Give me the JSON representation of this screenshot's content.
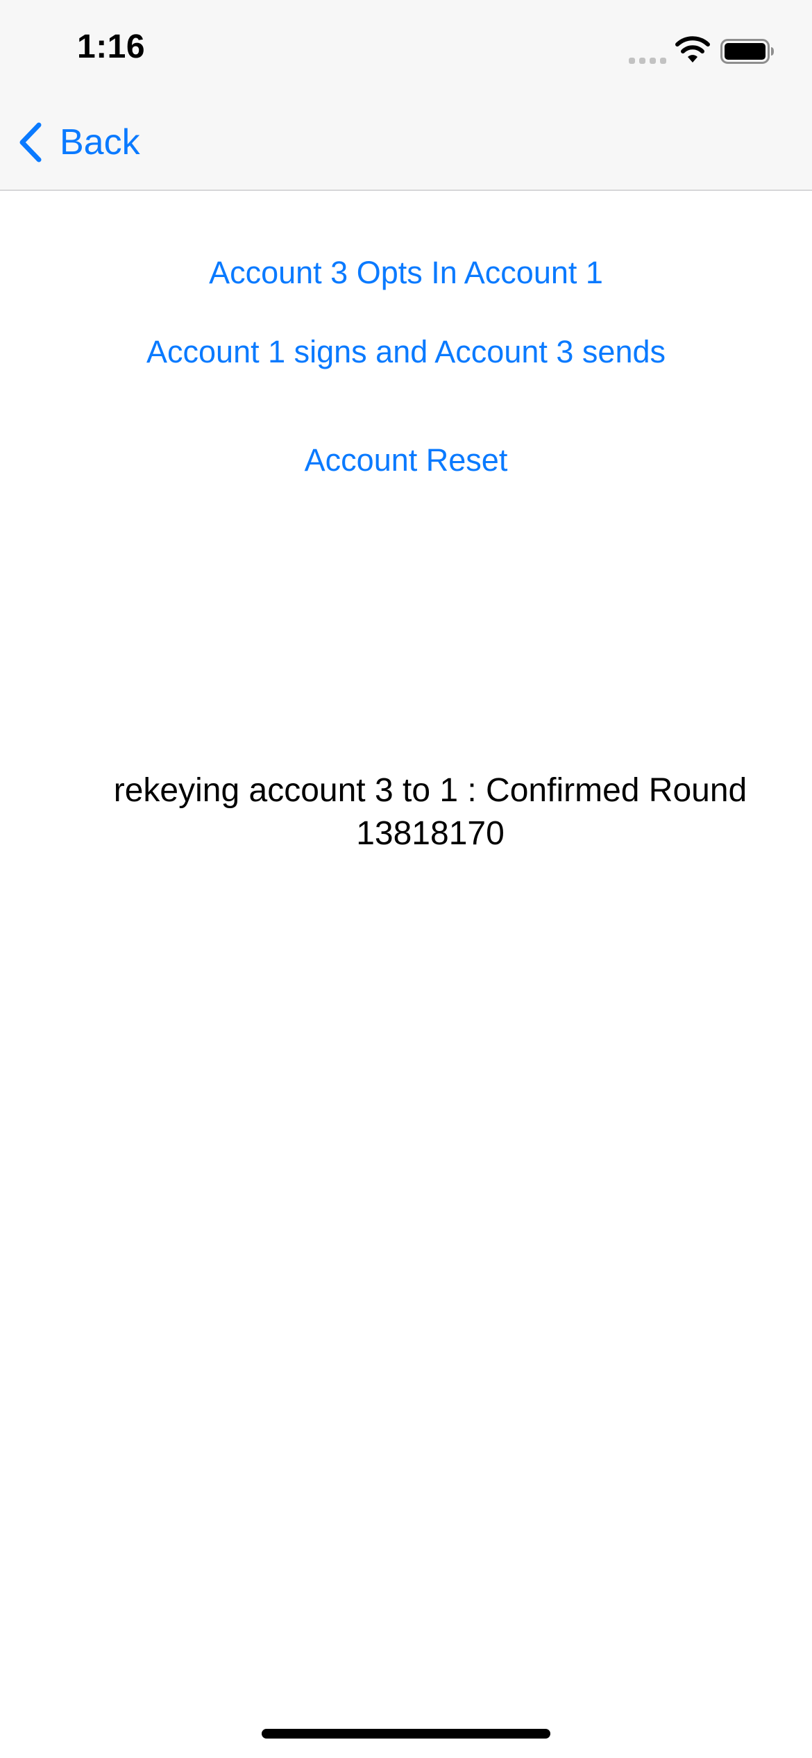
{
  "status_bar": {
    "time": "1:16",
    "signal_icon": "cellular-signal-icon",
    "wifi_icon": "wifi-icon",
    "battery_icon": "battery-full-icon"
  },
  "nav": {
    "back_label": "Back",
    "back_icon": "chevron-left-icon"
  },
  "actions": {
    "opt_in_label": "Account 3 Opts In Account 1",
    "sign_send_label": "Account 1 signs and Account 3 sends",
    "reset_label": "Account Reset"
  },
  "status": {
    "message": "rekeying account 3 to 1 : Confirmed Round 13818170"
  },
  "colors": {
    "accent": "#0a7aff",
    "nav_background": "#f7f7f7",
    "text": "#000000"
  }
}
